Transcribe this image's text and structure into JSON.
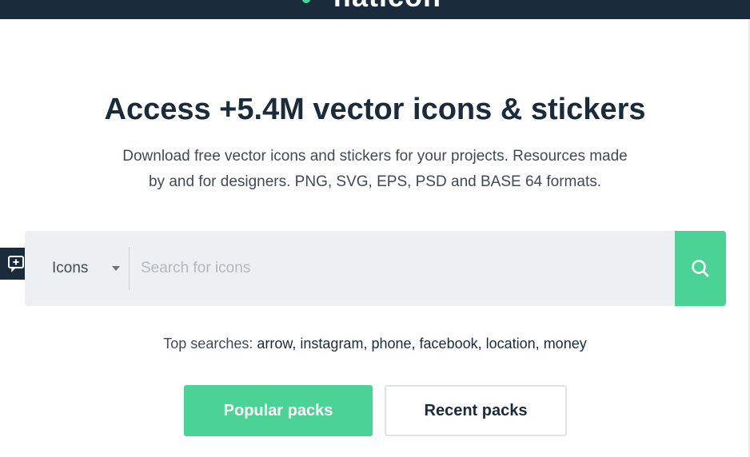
{
  "header": {
    "logo_text": "flaticon"
  },
  "hero": {
    "title": "Access +5.4M vector icons & stickers",
    "subtitle_line1": "Download free vector icons and stickers for your projects. Resources made",
    "subtitle_line2": "by and for designers. PNG, SVG, EPS, PSD and BASE 64 formats."
  },
  "search": {
    "type_selected": "Icons",
    "placeholder": "Search for icons",
    "button_icon": "search-icon"
  },
  "feedback": {
    "icon": "feedback-icon"
  },
  "top_searches": {
    "label": "Top searches:",
    "items": [
      "arrow,",
      "instagram,",
      "phone,",
      "facebook,",
      "location,",
      "money"
    ]
  },
  "buttons": {
    "popular": "Popular packs",
    "recent": "Recent packs"
  },
  "colors": {
    "navy": "#1a2b3c",
    "green": "#4bd395",
    "search_bg": "#edf0f3"
  }
}
